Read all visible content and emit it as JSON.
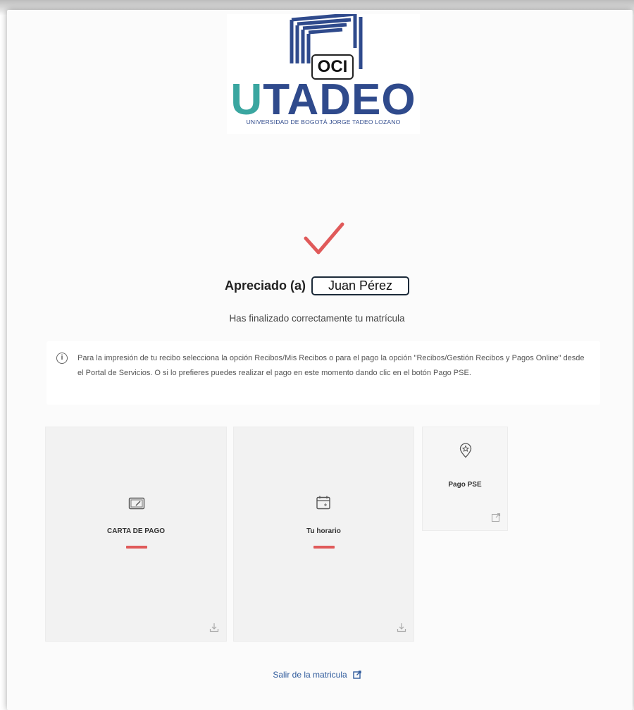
{
  "logo": {
    "badge": "OCI",
    "brand_first": "U",
    "brand_rest": "TADEO",
    "tagline": "UNIVERSIDAD DE BOGOTÁ JORGE TADEO LOZANO"
  },
  "confirmation": {
    "greeting_label": "Apreciado (a)",
    "student_name": "Juan Pérez",
    "message": "Has finalizado correctamente tu matrícula"
  },
  "info": {
    "icon": "info-icon",
    "text": "Para la impresión de tu recibo selecciona la opción Recibos/Mis Recibos o para el pago la opción \"Recibos/Gestión Recibos y Pagos Online\" desde el Portal de Servicios. O si lo prefieres puedes realizar el pago en este momento dando clic en el botón Pago PSE."
  },
  "cards": [
    {
      "title": "CARTA DE PAGO",
      "icon": "payment-card-icon",
      "action_icon": "download-icon"
    },
    {
      "title": "Tu horario",
      "icon": "calendar-icon",
      "action_icon": "download-icon"
    },
    {
      "title": "Pago PSE",
      "icon": "badge-star-icon",
      "action_icon": "external-link-icon"
    }
  ],
  "exit": {
    "label": "Salir de la matricula",
    "icon": "external-link-icon"
  },
  "colors": {
    "accent_red": "#e05a5a",
    "brand_blue": "#2f4a8c",
    "brand_teal": "#3aa6a0",
    "link_blue": "#2f5b9c"
  }
}
